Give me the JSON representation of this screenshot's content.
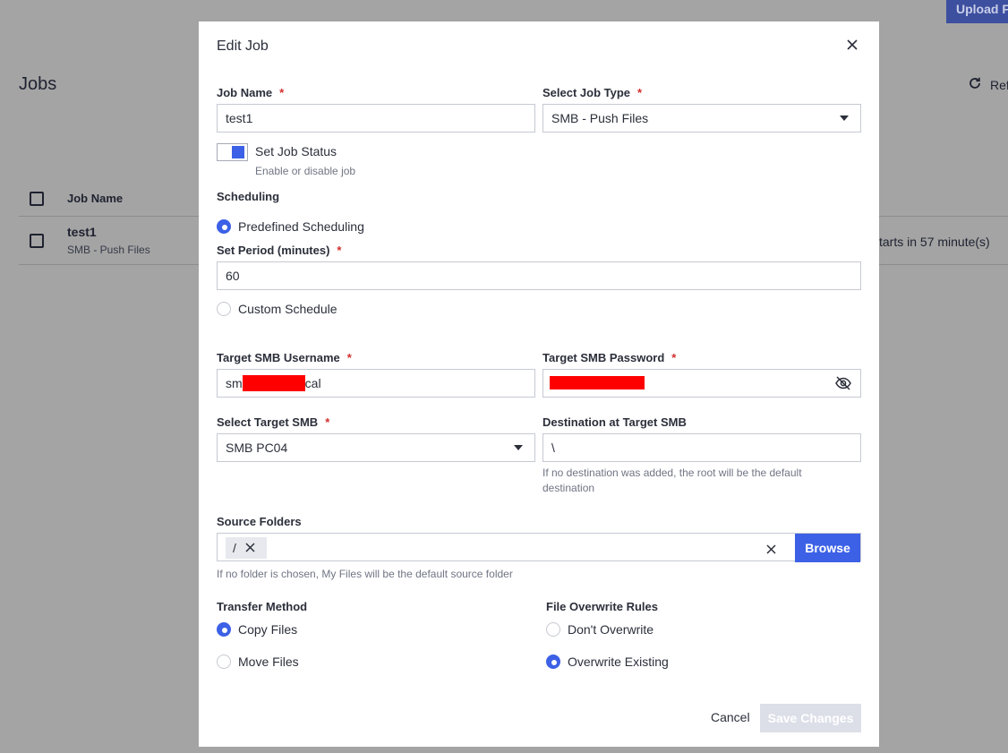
{
  "background": {
    "upload_label": "Upload Fi",
    "page_title": "Jobs",
    "refresh_label": "Ref",
    "table": {
      "header": "Job Name",
      "row_name": "test1",
      "row_type": "SMB - Push Files",
      "row_status": "tarts in 57 minute(s)"
    }
  },
  "modal": {
    "title": "Edit Job",
    "job_name_label": "Job Name",
    "job_name_value": "test1",
    "job_type_label": "Select Job Type",
    "job_type_value": "SMB - Push Files",
    "status_label": "Set Job Status",
    "status_hint": "Enable or disable job",
    "scheduling_label": "Scheduling",
    "predefined_label": "Predefined Scheduling",
    "period_label": "Set Period (minutes)",
    "period_value": "60",
    "custom_label": "Custom Schedule",
    "username_label": "Target SMB Username",
    "username_prefix": "sm",
    "username_suffix": "cal",
    "password_label": "Target SMB Password",
    "target_label": "Select Target SMB",
    "target_value": "SMB PC04",
    "destination_label": "Destination at Target SMB",
    "destination_value": "\\",
    "destination_hint_1": "If no destination was added, the root will be the default",
    "destination_hint_2": "destination",
    "source_label": "Source Folders",
    "source_chip": "/",
    "browse_label": "Browse",
    "source_hint": "If no folder is chosen, My Files will be the default source folder",
    "transfer_label": "Transfer Method",
    "copy_label": "Copy Files",
    "move_label": "Move Files",
    "overwrite_label": "File Overwrite Rules",
    "dont_overwrite_label": "Don't Overwrite",
    "overwrite_existing_label": "Overwrite Existing",
    "cancel_label": "Cancel",
    "save_label": "Save Changes",
    "required_mark": "*"
  },
  "colors": {
    "accent": "#3c61e6",
    "required": "#d32f2f",
    "overlay": "#a4a4a4",
    "redaction": "#ff0000"
  }
}
